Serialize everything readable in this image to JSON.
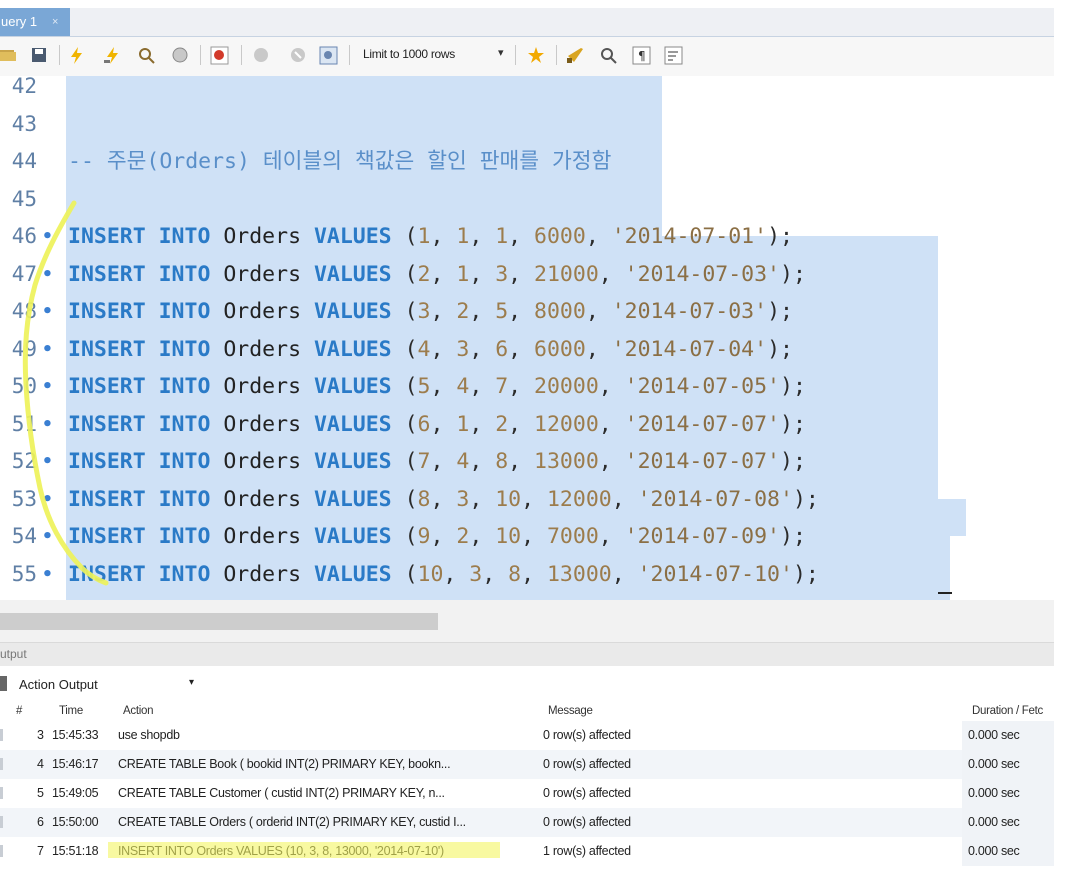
{
  "tab": {
    "title": "uery 1",
    "close": "×"
  },
  "toolbar": {
    "limit_label": "Limit to 1000 rows",
    "limit_caret": "▾"
  },
  "editor": {
    "lines": [
      {
        "no": "42",
        "dot": "",
        "code": []
      },
      {
        "no": "43",
        "dot": "",
        "code": []
      },
      {
        "no": "44",
        "dot": "",
        "code": [
          {
            "t": "cmt",
            "v": "-- 주문(Orders) 테이블의 책값은 할인 판매를 가정함"
          }
        ]
      },
      {
        "no": "45",
        "dot": "",
        "code": []
      },
      {
        "no": "46",
        "dot": "•",
        "code": [
          {
            "t": "kw",
            "v": "INSERT INTO "
          },
          {
            "t": "tbl",
            "v": "Orders "
          },
          {
            "t": "kw",
            "v": "VALUES "
          },
          {
            "t": "p",
            "v": "("
          },
          {
            "t": "num",
            "v": "1"
          },
          {
            "t": "p",
            "v": ", "
          },
          {
            "t": "num",
            "v": "1"
          },
          {
            "t": "p",
            "v": ", "
          },
          {
            "t": "num",
            "v": "1"
          },
          {
            "t": "p",
            "v": ", "
          },
          {
            "t": "num",
            "v": "6000"
          },
          {
            "t": "p",
            "v": ", "
          },
          {
            "t": "str",
            "v": "'2014-07-01'"
          },
          {
            "t": "p",
            "v": ");"
          }
        ]
      },
      {
        "no": "47",
        "dot": "•",
        "code": [
          {
            "t": "kw",
            "v": "INSERT INTO "
          },
          {
            "t": "tbl",
            "v": "Orders "
          },
          {
            "t": "kw",
            "v": "VALUES "
          },
          {
            "t": "p",
            "v": "("
          },
          {
            "t": "num",
            "v": "2"
          },
          {
            "t": "p",
            "v": ", "
          },
          {
            "t": "num",
            "v": "1"
          },
          {
            "t": "p",
            "v": ", "
          },
          {
            "t": "num",
            "v": "3"
          },
          {
            "t": "p",
            "v": ", "
          },
          {
            "t": "num",
            "v": "21000"
          },
          {
            "t": "p",
            "v": ", "
          },
          {
            "t": "str",
            "v": "'2014-07-03'"
          },
          {
            "t": "p",
            "v": ");"
          }
        ]
      },
      {
        "no": "48",
        "dot": "•",
        "code": [
          {
            "t": "kw",
            "v": "INSERT INTO "
          },
          {
            "t": "tbl",
            "v": "Orders "
          },
          {
            "t": "kw",
            "v": "VALUES "
          },
          {
            "t": "p",
            "v": "("
          },
          {
            "t": "num",
            "v": "3"
          },
          {
            "t": "p",
            "v": ", "
          },
          {
            "t": "num",
            "v": "2"
          },
          {
            "t": "p",
            "v": ", "
          },
          {
            "t": "num",
            "v": "5"
          },
          {
            "t": "p",
            "v": ", "
          },
          {
            "t": "num",
            "v": "8000"
          },
          {
            "t": "p",
            "v": ", "
          },
          {
            "t": "str",
            "v": "'2014-07-03'"
          },
          {
            "t": "p",
            "v": ");"
          }
        ]
      },
      {
        "no": "49",
        "dot": "•",
        "code": [
          {
            "t": "kw",
            "v": "INSERT INTO "
          },
          {
            "t": "tbl",
            "v": "Orders "
          },
          {
            "t": "kw",
            "v": "VALUES "
          },
          {
            "t": "p",
            "v": "("
          },
          {
            "t": "num",
            "v": "4"
          },
          {
            "t": "p",
            "v": ", "
          },
          {
            "t": "num",
            "v": "3"
          },
          {
            "t": "p",
            "v": ", "
          },
          {
            "t": "num",
            "v": "6"
          },
          {
            "t": "p",
            "v": ", "
          },
          {
            "t": "num",
            "v": "6000"
          },
          {
            "t": "p",
            "v": ", "
          },
          {
            "t": "str",
            "v": "'2014-07-04'"
          },
          {
            "t": "p",
            "v": ");"
          }
        ]
      },
      {
        "no": "50",
        "dot": "•",
        "code": [
          {
            "t": "kw",
            "v": "INSERT INTO "
          },
          {
            "t": "tbl",
            "v": "Orders "
          },
          {
            "t": "kw",
            "v": "VALUES "
          },
          {
            "t": "p",
            "v": "("
          },
          {
            "t": "num",
            "v": "5"
          },
          {
            "t": "p",
            "v": ", "
          },
          {
            "t": "num",
            "v": "4"
          },
          {
            "t": "p",
            "v": ", "
          },
          {
            "t": "num",
            "v": "7"
          },
          {
            "t": "p",
            "v": ", "
          },
          {
            "t": "num",
            "v": "20000"
          },
          {
            "t": "p",
            "v": ", "
          },
          {
            "t": "str",
            "v": "'2014-07-05'"
          },
          {
            "t": "p",
            "v": ");"
          }
        ]
      },
      {
        "no": "51",
        "dot": "•",
        "code": [
          {
            "t": "kw",
            "v": "INSERT INTO "
          },
          {
            "t": "tbl",
            "v": "Orders "
          },
          {
            "t": "kw",
            "v": "VALUES "
          },
          {
            "t": "p",
            "v": "("
          },
          {
            "t": "num",
            "v": "6"
          },
          {
            "t": "p",
            "v": ", "
          },
          {
            "t": "num",
            "v": "1"
          },
          {
            "t": "p",
            "v": ", "
          },
          {
            "t": "num",
            "v": "2"
          },
          {
            "t": "p",
            "v": ", "
          },
          {
            "t": "num",
            "v": "12000"
          },
          {
            "t": "p",
            "v": ", "
          },
          {
            "t": "str",
            "v": "'2014-07-07'"
          },
          {
            "t": "p",
            "v": ");"
          }
        ]
      },
      {
        "no": "52",
        "dot": "•",
        "code": [
          {
            "t": "kw",
            "v": "INSERT INTO "
          },
          {
            "t": "tbl",
            "v": "Orders "
          },
          {
            "t": "kw",
            "v": "VALUES "
          },
          {
            "t": "p",
            "v": "("
          },
          {
            "t": "num",
            "v": "7"
          },
          {
            "t": "p",
            "v": ", "
          },
          {
            "t": "num",
            "v": "4"
          },
          {
            "t": "p",
            "v": ", "
          },
          {
            "t": "num",
            "v": "8"
          },
          {
            "t": "p",
            "v": ", "
          },
          {
            "t": "num",
            "v": "13000"
          },
          {
            "t": "p",
            "v": ", "
          },
          {
            "t": "str",
            "v": "'2014-07-07'"
          },
          {
            "t": "p",
            "v": ");"
          }
        ]
      },
      {
        "no": "53",
        "dot": "•",
        "code": [
          {
            "t": "kw",
            "v": "INSERT INTO "
          },
          {
            "t": "tbl",
            "v": "Orders "
          },
          {
            "t": "kw",
            "v": "VALUES "
          },
          {
            "t": "p",
            "v": "("
          },
          {
            "t": "num",
            "v": "8"
          },
          {
            "t": "p",
            "v": ", "
          },
          {
            "t": "num",
            "v": "3"
          },
          {
            "t": "p",
            "v": ", "
          },
          {
            "t": "num",
            "v": "10"
          },
          {
            "t": "p",
            "v": ", "
          },
          {
            "t": "num",
            "v": "12000"
          },
          {
            "t": "p",
            "v": ", "
          },
          {
            "t": "str",
            "v": "'2014-07-08'"
          },
          {
            "t": "p",
            "v": ");"
          }
        ]
      },
      {
        "no": "54",
        "dot": "•",
        "code": [
          {
            "t": "kw",
            "v": "INSERT INTO "
          },
          {
            "t": "tbl",
            "v": "Orders "
          },
          {
            "t": "kw",
            "v": "VALUES "
          },
          {
            "t": "p",
            "v": "("
          },
          {
            "t": "num",
            "v": "9"
          },
          {
            "t": "p",
            "v": ", "
          },
          {
            "t": "num",
            "v": "2"
          },
          {
            "t": "p",
            "v": ", "
          },
          {
            "t": "num",
            "v": "10"
          },
          {
            "t": "p",
            "v": ", "
          },
          {
            "t": "num",
            "v": "7000"
          },
          {
            "t": "p",
            "v": ", "
          },
          {
            "t": "str",
            "v": "'2014-07-09'"
          },
          {
            "t": "p",
            "v": ");"
          }
        ]
      },
      {
        "no": "55",
        "dot": "•",
        "code": [
          {
            "t": "kw",
            "v": "INSERT INTO "
          },
          {
            "t": "tbl",
            "v": "Orders "
          },
          {
            "t": "kw",
            "v": "VALUES "
          },
          {
            "t": "p",
            "v": "("
          },
          {
            "t": "num",
            "v": "10"
          },
          {
            "t": "p",
            "v": ", "
          },
          {
            "t": "num",
            "v": "3"
          },
          {
            "t": "p",
            "v": ", "
          },
          {
            "t": "num",
            "v": "8"
          },
          {
            "t": "p",
            "v": ", "
          },
          {
            "t": "num",
            "v": "13000"
          },
          {
            "t": "p",
            "v": ", "
          },
          {
            "t": "str",
            "v": "'2014-07-10'"
          },
          {
            "t": "p",
            "v": ");"
          }
        ]
      }
    ]
  },
  "output": {
    "panel_label": "utput",
    "selector_label": "Action Output",
    "selector_caret": "▾",
    "headers": {
      "no": "#",
      "time": "Time",
      "action": "Action",
      "message": "Message",
      "duration": "Duration / Fetc"
    },
    "rows": [
      {
        "no": "3",
        "time": "15:45:33",
        "action": "use shopdb",
        "message": "0 row(s) affected",
        "duration": "0.000 sec"
      },
      {
        "no": "4",
        "time": "15:46:17",
        "action": "CREATE TABLE Book (   bookid     INT(2) PRIMARY KEY,   bookn...",
        "message": "0 row(s) affected",
        "duration": "0.000 sec"
      },
      {
        "no": "5",
        "time": "15:49:05",
        "action": "CREATE TABLE  Customer (   custid      INT(2) PRIMARY KEY,     n...",
        "message": "0 row(s) affected",
        "duration": "0.000 sec"
      },
      {
        "no": "6",
        "time": "15:50:00",
        "action": "CREATE TABLE Orders (   orderid INT(2) PRIMARY KEY,   custid  I...",
        "message": "0 row(s) affected",
        "duration": "0.000 sec"
      },
      {
        "no": "7",
        "time": "15:51:18",
        "action": "INSERT INTO Orders VALUES (10, 3, 8, 13000, '2014-07-10')",
        "message": "1 row(s) affected",
        "duration": "0.000 sec"
      }
    ]
  },
  "colors": {
    "keyword": "#2a7ac7",
    "number": "#9c7c4c",
    "string": "#8b6f45",
    "comment": "#5a8fc9",
    "selection": "#cfe1f6",
    "highlighter": "#eef25a"
  }
}
